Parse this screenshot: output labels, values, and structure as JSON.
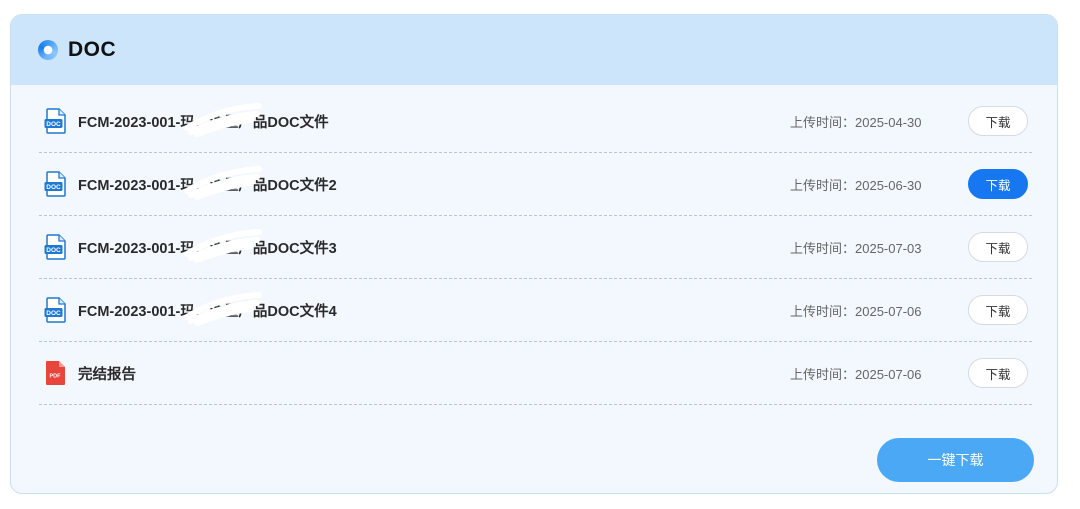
{
  "section": {
    "title": "DOC",
    "icon": "circle-logo-icon"
  },
  "files": [
    {
      "name": "FCM-2023-001-玛…油墨产品DOC文件",
      "time_label": "上传时间：",
      "time": "2025-04-30",
      "type": "doc",
      "icon": "doc-file-icon",
      "button": "下载",
      "active": false
    },
    {
      "name": "FCM-2023-001-玛…油墨产品DOC文件2",
      "time_label": "上传时间：",
      "time": "2025-06-30",
      "type": "doc",
      "icon": "doc-file-icon",
      "button": "下载",
      "active": true
    },
    {
      "name": "FCM-2023-001-玛…油墨产品DOC文件3",
      "time_label": "上传时间：",
      "time": "2025-07-03",
      "type": "doc",
      "icon": "doc-file-icon",
      "button": "下载",
      "active": false
    },
    {
      "name": "FCM-2023-001-玛…油墨产品DOC文件4",
      "time_label": "上传时间：",
      "time": "2025-07-06",
      "type": "doc",
      "icon": "doc-file-icon",
      "button": "下载",
      "active": false
    },
    {
      "name": "完结报告",
      "time_label": "上传时间：",
      "time": "2025-07-06",
      "type": "pdf",
      "icon": "pdf-file-icon",
      "button": "下载",
      "active": false
    }
  ],
  "download_all_label": "一键下载",
  "colors": {
    "header_bg": "#cde5fb",
    "panel_bg": "#f2f8fe",
    "primary": "#1677f0",
    "download_all": "#4aa8f5",
    "pdf": "#e8453c"
  }
}
